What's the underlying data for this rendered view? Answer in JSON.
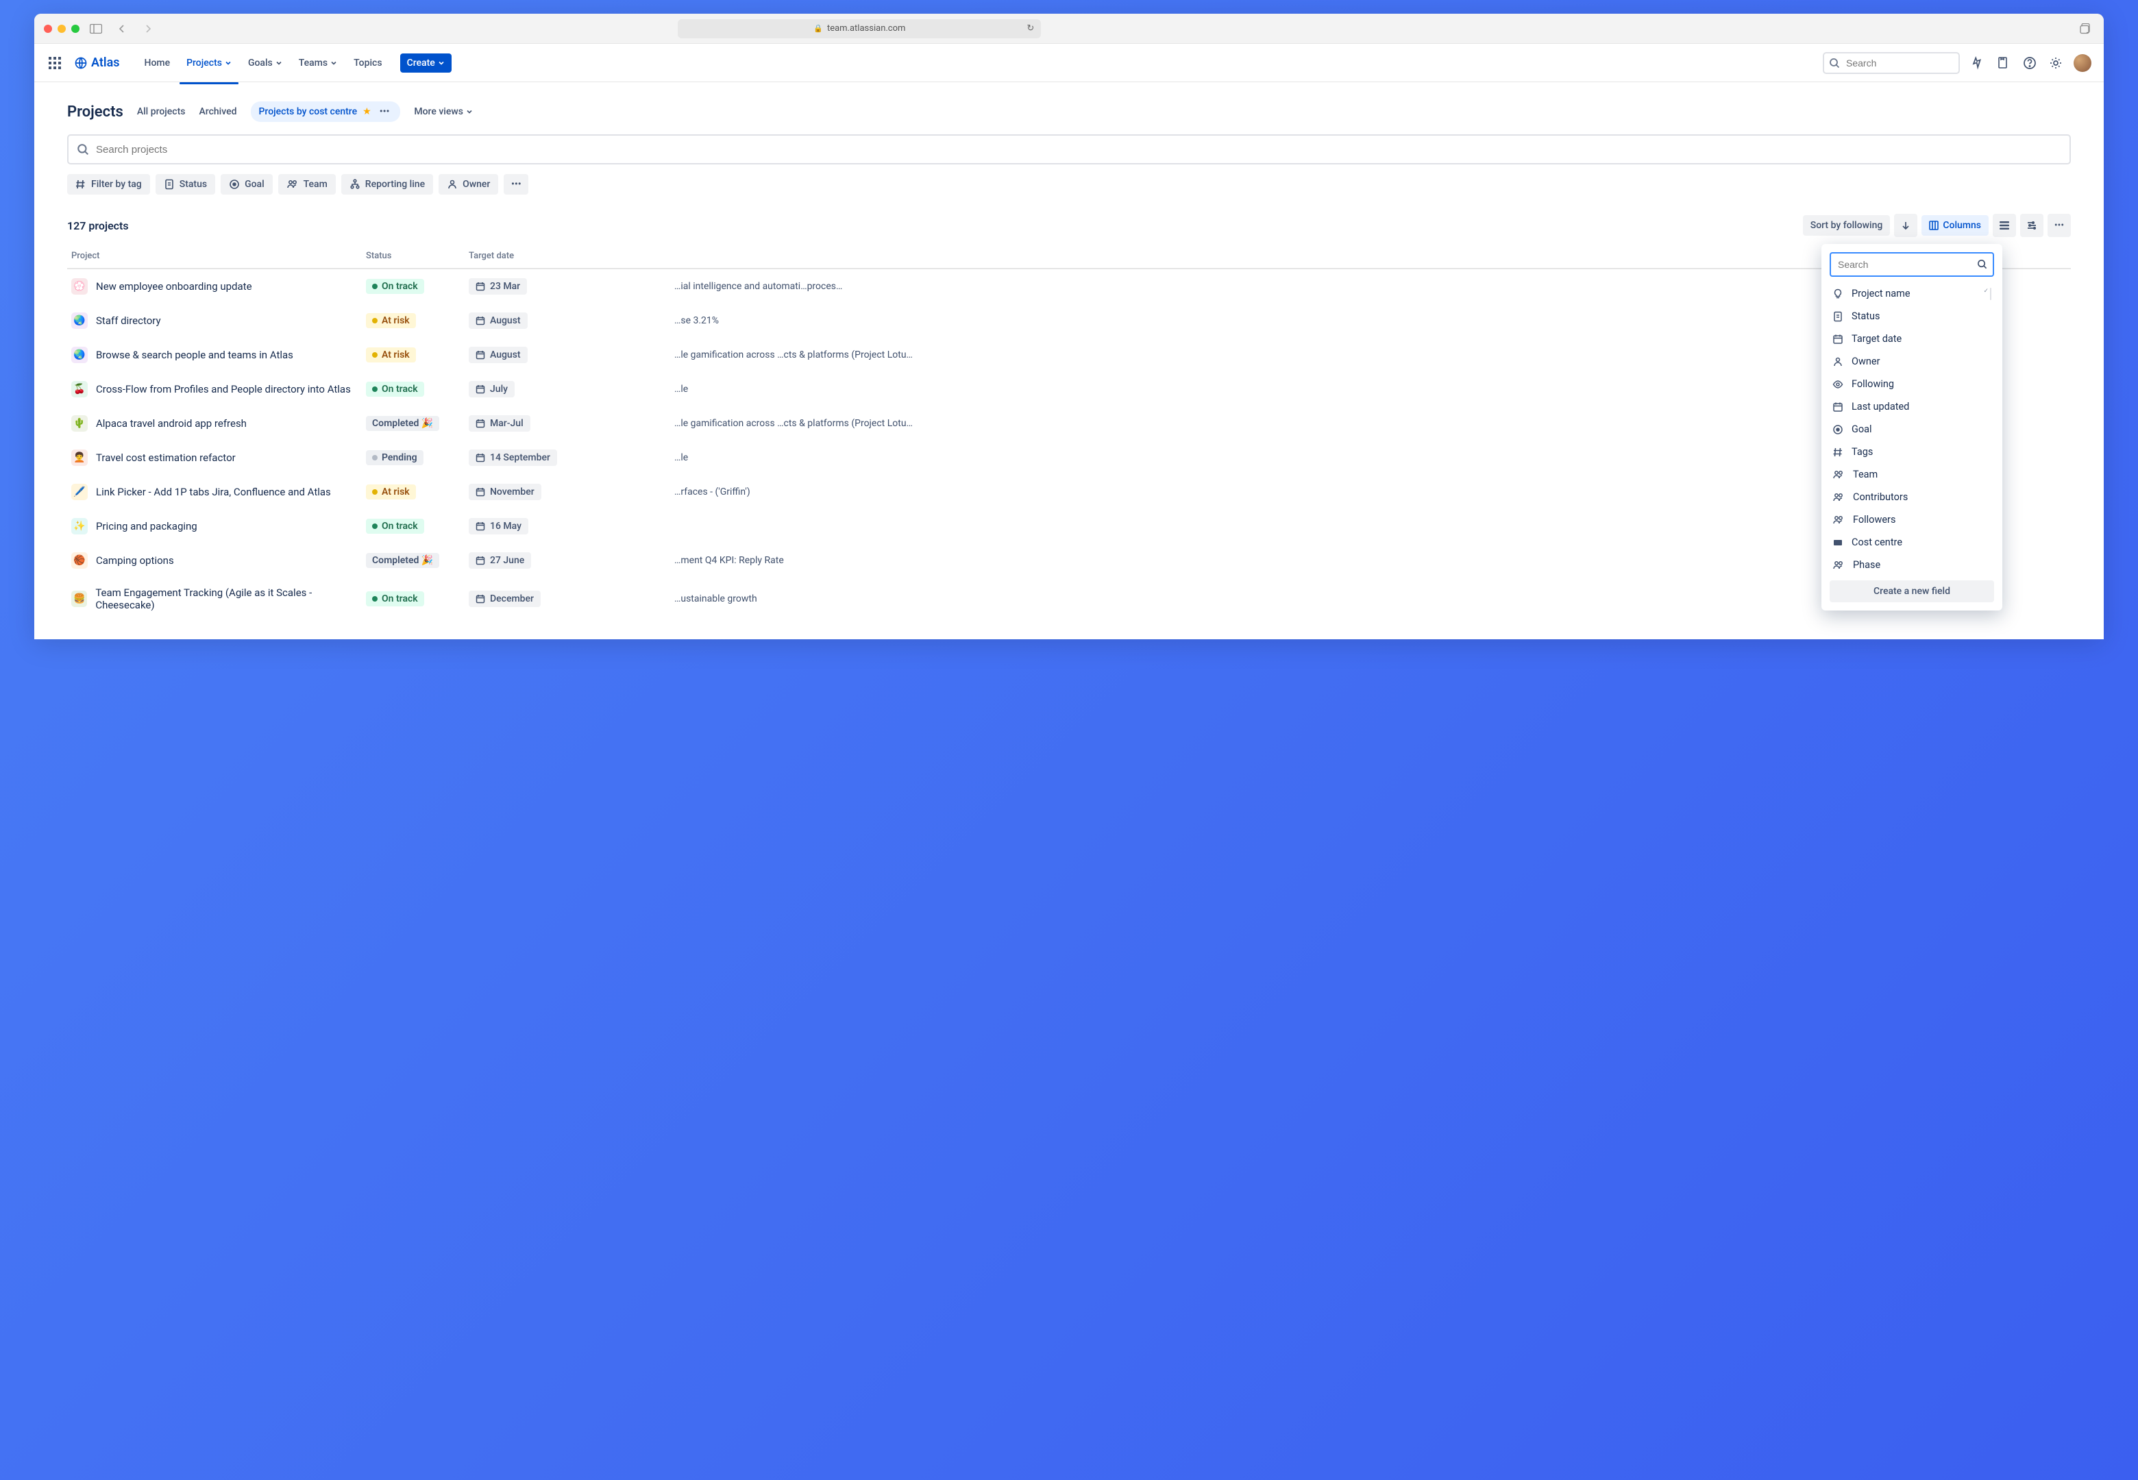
{
  "browser": {
    "domain": "team.atlassian.com"
  },
  "app": {
    "name": "Atlas",
    "nav": {
      "home": "Home",
      "projects": "Projects",
      "goals": "Goals",
      "teams": "Teams",
      "topics": "Topics"
    },
    "create": "Create",
    "search_placeholder": "Search"
  },
  "page": {
    "title": "Projects",
    "tabs": {
      "all": "All projects",
      "archived": "Archived",
      "view": "Projects by cost centre",
      "more": "More views"
    },
    "search_placeholder": "Search projects",
    "filters": {
      "tag": "Filter by tag",
      "status": "Status",
      "goal": "Goal",
      "team": "Team",
      "reporting": "Reporting line",
      "owner": "Owner"
    },
    "count": "127 projects",
    "sort": "Sort by following",
    "columns_btn": "Columns"
  },
  "columns": {
    "project": "Project",
    "status": "Status",
    "target": "Target date"
  },
  "rows": [
    {
      "icon": "💮",
      "bg": "#f9e6e9",
      "name": "New employee onboarding update",
      "status": "On track",
      "st": "ontrack",
      "date": "23 Mar",
      "goal": "…ial intelligence and automati…proces…"
    },
    {
      "icon": "🌏",
      "bg": "#f3e8fa",
      "name": "Staff directory",
      "status": "At risk",
      "st": "atrisk",
      "date": "August",
      "goal": "…se 3.21%"
    },
    {
      "icon": "🌏",
      "bg": "#f3e8fa",
      "name": "Browse & search people and teams in Atlas",
      "status": "At risk",
      "st": "atrisk",
      "date": "August",
      "goal": "…le gamification across …cts & platforms (Project Lotu…"
    },
    {
      "icon": "🍒",
      "bg": "#e5f6ec",
      "name": "Cross-Flow from Profiles and People directory into Atlas",
      "status": "On track",
      "st": "ontrack",
      "date": "July",
      "goal": "…le"
    },
    {
      "icon": "🌵",
      "bg": "#eef2e6",
      "name": "Alpaca travel android app refresh",
      "status": "Completed 🎉",
      "st": "completed",
      "date": "Mar-Jul",
      "goal": "…le gamification across …cts & platforms (Project Lotu…"
    },
    {
      "icon": "🧑‍🦱",
      "bg": "#fbe9e5",
      "name": "Travel cost estimation refactor",
      "status": "Pending",
      "st": "pending",
      "date": "14 September",
      "goal": "…le"
    },
    {
      "icon": "🖊️",
      "bg": "#fff5db",
      "name": "Link Picker - Add 1P tabs Jira, Confluence and Atlas",
      "status": "At risk",
      "st": "atrisk",
      "date": "November",
      "goal": "…rfaces - ('Griffin')"
    },
    {
      "icon": "✨",
      "bg": "#e2f8f6",
      "name": "Pricing and packaging",
      "status": "On track",
      "st": "ontrack",
      "date": "16 May",
      "goal": ""
    },
    {
      "icon": "🏀",
      "bg": "#fff1e1",
      "name": "Camping options",
      "status": "Completed 🎉",
      "st": "completed",
      "date": "27 June",
      "goal": "…ment Q4 KPI: Reply Rate"
    },
    {
      "icon": "🍔",
      "bg": "#eaf3e2",
      "name": "Team Engagement Tracking (Agile as it Scales - Cheesecake)",
      "status": "On track",
      "st": "ontrack",
      "date": "December",
      "goal": "…ustainable growth"
    }
  ],
  "popover": {
    "search_placeholder": "Search",
    "items": [
      {
        "icon": "bulb",
        "label": "Project name",
        "locked": true
      },
      {
        "icon": "status",
        "label": "Status",
        "on": true
      },
      {
        "icon": "cal",
        "label": "Target date",
        "on": true
      },
      {
        "icon": "user",
        "label": "Owner",
        "on": false
      },
      {
        "icon": "eye",
        "label": "Following",
        "on": false
      },
      {
        "icon": "cal",
        "label": "Last updated",
        "on": false
      },
      {
        "icon": "goal",
        "label": "Goal",
        "on": true
      },
      {
        "icon": "hash",
        "label": "Tags",
        "on": false
      },
      {
        "icon": "team",
        "label": "Team",
        "on": false
      },
      {
        "icon": "team",
        "label": "Contributors",
        "on": false
      },
      {
        "icon": "team",
        "label": "Followers",
        "on": false
      },
      {
        "icon": "cost",
        "label": "Cost centre",
        "on": true
      },
      {
        "icon": "team",
        "label": "Phase",
        "on": false
      }
    ],
    "new_field": "Create a new field"
  }
}
